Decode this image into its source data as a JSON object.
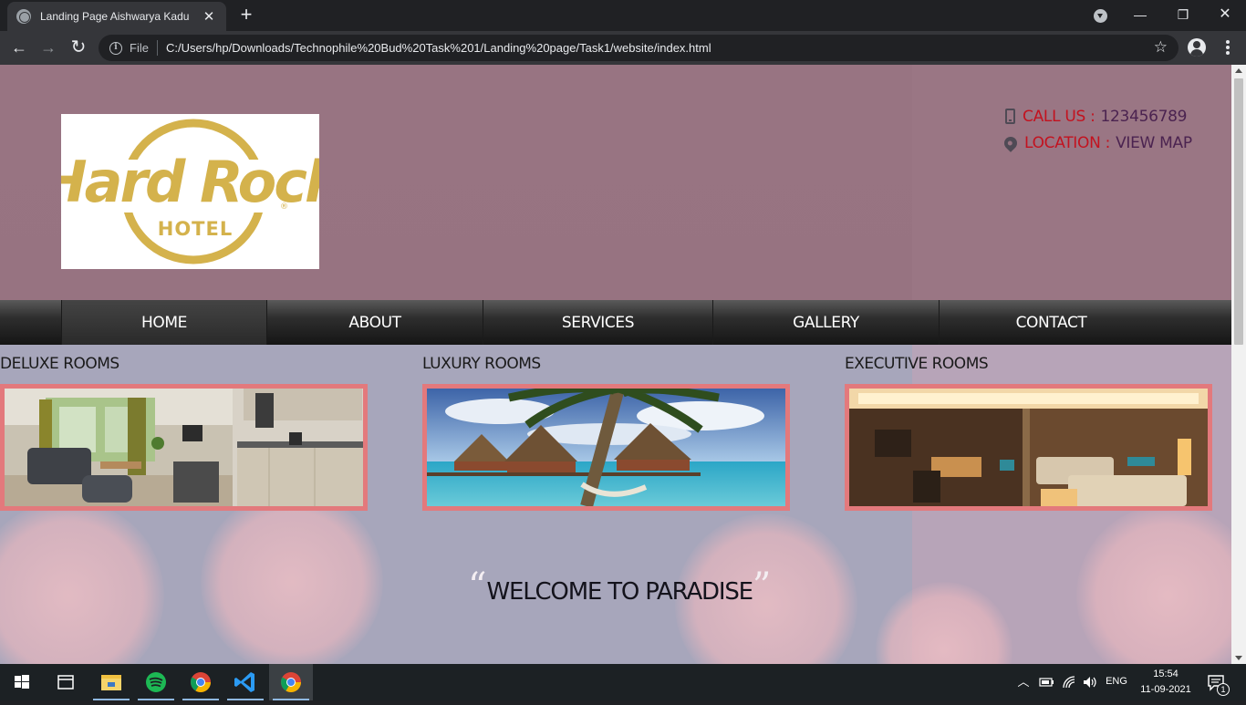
{
  "browser": {
    "tab_title": "Landing Page Aishwarya Kadu",
    "tab_close": "✕",
    "new_tab": "+",
    "address_file_label": "File",
    "address_url": "C:/Users/hp/Downloads/Technophile%20Bud%20Task%201/Landing%20page/Task1/website/index.html",
    "window_controls": {
      "minimize": "—",
      "maximize": "❐",
      "close": "✕"
    },
    "nav": {
      "back": "←",
      "forward": "→",
      "reload": "↻"
    },
    "star": "☆"
  },
  "page": {
    "logo": {
      "line1": "Hard Rock",
      "line2": "HOTEL",
      "mark": "®",
      "color": "#d4b24c"
    },
    "contact": {
      "call_label": "CALL US :",
      "call_value": "123456789",
      "location_label": "LOCATION :",
      "location_value": "VIEW MAP"
    },
    "nav": [
      {
        "label": "HOME",
        "active": true
      },
      {
        "label": "ABOUT",
        "active": false
      },
      {
        "label": "SERVICES",
        "active": false
      },
      {
        "label": "GALLERY",
        "active": false
      },
      {
        "label": "CONTACT",
        "active": false
      }
    ],
    "rooms": [
      {
        "title": "DELUXE ROOMS",
        "image": "deluxe-room-photo"
      },
      {
        "title": "LUXURY ROOMS",
        "image": "overwater-villa-photo"
      },
      {
        "title": "EXECUTIVE ROOMS",
        "image": "executive-room-photo"
      }
    ],
    "welcome": {
      "open_quote": "“",
      "text": "WELCOME TO PARADISE",
      "close_quote": "”"
    },
    "colors": {
      "accent_red": "#c3121f",
      "contact_value": "#4b2350",
      "frame_border": "#e3797c"
    }
  },
  "taskbar": {
    "apps": [
      "windows-start",
      "task-view",
      "file-explorer",
      "spotify",
      "chrome",
      "vscode",
      "chrome-active"
    ],
    "lang": "ENG",
    "time": "15:54",
    "date": "11-09-2021",
    "notifications": "1"
  }
}
